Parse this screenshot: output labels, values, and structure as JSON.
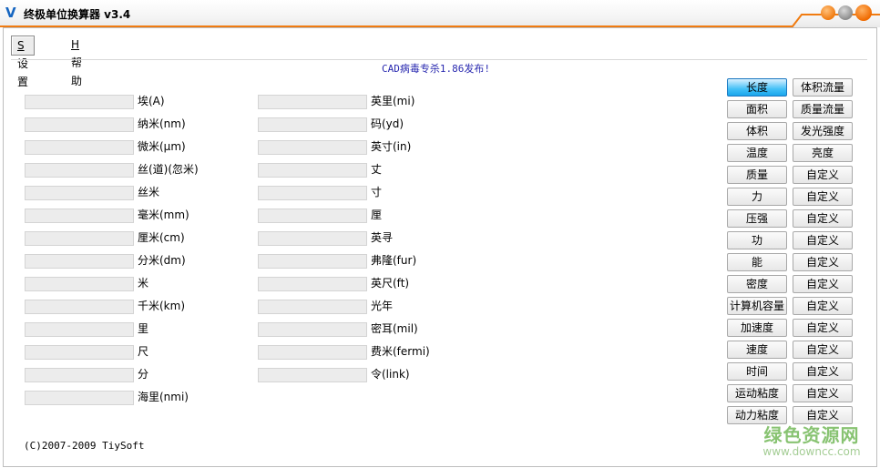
{
  "window": {
    "title": "终极单位换算器 v3.4",
    "logo_glyph": "V"
  },
  "menu": [
    {
      "key": "S",
      "label": "设置"
    },
    {
      "key": "H",
      "label": "帮助"
    }
  ],
  "announcement": "CAD病毒专杀1.86发布!",
  "units_col1": [
    "埃(A)",
    "纳米(nm)",
    "微米(μm)",
    "丝(道)(忽米)",
    "丝米",
    "毫米(mm)",
    "厘米(cm)",
    "分米(dm)",
    "米",
    "千米(km)",
    "里",
    "尺",
    "分",
    "海里(nmi)"
  ],
  "units_col2": [
    "英里(mi)",
    "码(yd)",
    "英寸(in)",
    "丈",
    "寸",
    "厘",
    "英寻",
    "弗隆(fur)",
    "英尺(ft)",
    "光年",
    "密耳(mil)",
    "费米(fermi)",
    "令(link)"
  ],
  "categories_left": [
    "长度",
    "面积",
    "体积",
    "温度",
    "质量",
    "力",
    "压强",
    "功",
    "能",
    "密度",
    "计算机容量",
    "加速度",
    "速度",
    "时间",
    "运动粘度",
    "动力粘度"
  ],
  "categories_right": [
    "体积流量",
    "质量流量",
    "发光强度",
    "亮度",
    "自定义",
    "自定义",
    "自定义",
    "自定义",
    "自定义",
    "自定义",
    "自定义",
    "自定义",
    "自定义",
    "自定义",
    "自定义",
    "自定义"
  ],
  "selected_category": "长度",
  "footer": "(C)2007-2009 TiySoft",
  "watermark": {
    "line1": "绿色资源网",
    "line2": "www.downcc.com"
  },
  "colors": {
    "accent_orange": "#f07b10",
    "selected_blue": "#43c0f7",
    "announce_blue": "#2a2ab0"
  }
}
